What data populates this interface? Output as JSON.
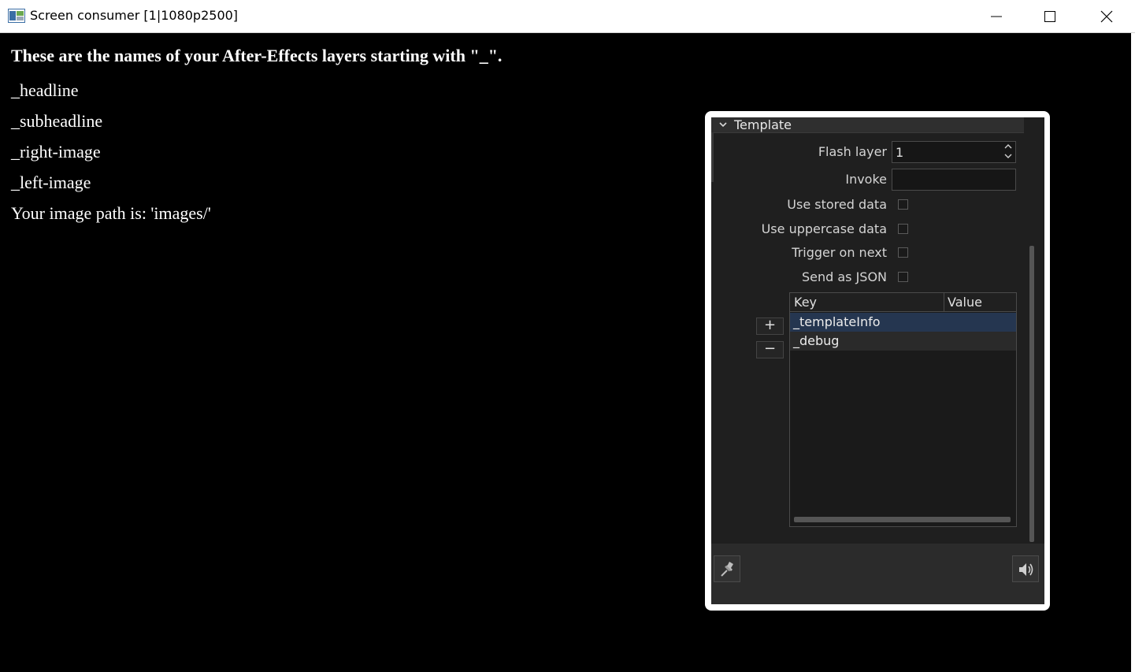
{
  "window": {
    "title": "Screen consumer [1|1080p2500]",
    "app_icon": "app-window-icon",
    "controls": [
      "minimize-icon",
      "maximize-icon",
      "close-icon"
    ]
  },
  "page": {
    "heading": "These are the names of your After-Effects layers starting with \"_\".",
    "layers": [
      "_headline",
      "_subheadline",
      "_right-image",
      "_left-image"
    ],
    "image_path_text": "Your image path is: 'images/'"
  },
  "panel": {
    "section_title": "Template",
    "flash_layer_label": "Flash layer",
    "flash_layer_value": "1",
    "invoke_label": "Invoke",
    "invoke_value": "",
    "use_stored_data_label": "Use stored data",
    "use_uppercase_data_label": "Use uppercase data",
    "trigger_on_next_label": "Trigger on next",
    "send_as_json_label": "Send as JSON",
    "checkboxes": {
      "use_stored_data": false,
      "use_uppercase_data": false,
      "trigger_on_next": false,
      "send_as_json": false
    },
    "table": {
      "columns": [
        "Key",
        "Value"
      ],
      "rows": [
        {
          "key": "_templateInfo",
          "value": "",
          "selected": true
        },
        {
          "key": "_debug",
          "value": "",
          "selected": false
        }
      ]
    },
    "add_row_label": "+",
    "remove_row_label": "−",
    "footer_icons": [
      "pin-icon",
      "speaker-icon"
    ]
  },
  "colors": {
    "background": "#000000",
    "panel_bg": "#1e1e1e",
    "selection": "#253650",
    "text_light": "#ffffff"
  }
}
